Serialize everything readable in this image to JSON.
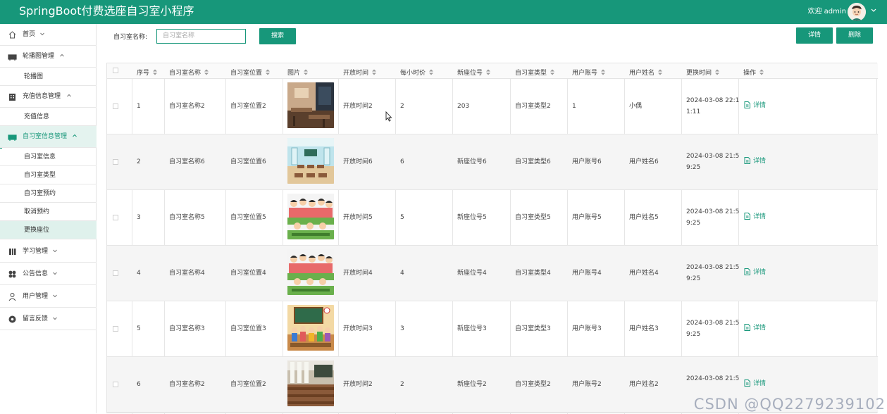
{
  "app": {
    "title": "SpringBoot付费选座自习室小程序",
    "welcome": "欢迎 admin"
  },
  "sidebar": {
    "items": [
      {
        "label": "首页",
        "icon": "home-icon",
        "expanded": false
      },
      {
        "label": "轮播图管理",
        "icon": "carousel-icon",
        "expanded": true
      },
      {
        "label": "充值信息管理",
        "icon": "building-icon",
        "expanded": true
      },
      {
        "label": "自习室信息管理",
        "icon": "carousel-icon",
        "expanded": true
      },
      {
        "label": "学习管理",
        "icon": "book-icon",
        "expanded": false
      },
      {
        "label": "公告信息",
        "icon": "grid-icon",
        "expanded": false
      },
      {
        "label": "用户管理",
        "icon": "user-icon",
        "expanded": false
      },
      {
        "label": "留言反馈",
        "icon": "feedback-icon",
        "expanded": false
      }
    ],
    "subitems": {
      "carousel": [
        "轮播图"
      ],
      "recharge": [
        "充值信息"
      ],
      "room": [
        "自习室信息",
        "自习室类型",
        "自习室预约",
        "取消预约",
        "更换座位"
      ]
    }
  },
  "search": {
    "label": "自习室名称:",
    "placeholder": "自习室名称",
    "button": "搜索"
  },
  "actions": {
    "detail": "详情",
    "delete": "删除"
  },
  "table": {
    "headers": [
      "序号",
      "自习室名称",
      "自习室位置",
      "图片",
      "开放时间",
      "每小时价",
      "新座位号",
      "自习室类型",
      "用户账号",
      "用户姓名",
      "更换时间",
      "操作"
    ],
    "rows": [
      {
        "idx": "1",
        "name": "自习室名称2",
        "pos": "自习室位置2",
        "open": "开放时间2",
        "price": "2",
        "seat": "203",
        "type": "自习室类型2",
        "account": "1",
        "user": "小偶",
        "time1": "2024-03-08 22:1",
        "time2": "1:11",
        "img": "classroom-photo"
      },
      {
        "idx": "2",
        "name": "自习室名称6",
        "pos": "自习室位置6",
        "open": "开放时间6",
        "price": "6",
        "seat": "新座位号6",
        "type": "自习室类型6",
        "account": "用户账号6",
        "user": "用户姓名6",
        "time1": "2024-03-08 21:5",
        "time2": "9:25",
        "img": "empty-classroom-illustration"
      },
      {
        "idx": "3",
        "name": "自习室名称5",
        "pos": "自习室位置5",
        "open": "开放时间5",
        "price": "5",
        "seat": "新座位号5",
        "type": "自习室类型5",
        "account": "用户账号5",
        "user": "用户姓名5",
        "time1": "2024-03-08 21:5",
        "time2": "9:25",
        "img": "students-cartoon"
      },
      {
        "idx": "4",
        "name": "自习室名称4",
        "pos": "自习室位置4",
        "open": "开放时间4",
        "price": "4",
        "seat": "新座位号4",
        "type": "自习室类型4",
        "account": "用户账号4",
        "user": "用户姓名4",
        "time1": "2024-03-08 21:5",
        "time2": "9:25",
        "img": "students-cartoon"
      },
      {
        "idx": "5",
        "name": "自习室名称3",
        "pos": "自习室位置3",
        "open": "开放时间3",
        "price": "3",
        "seat": "新座位号3",
        "type": "自习室类型3",
        "account": "用户账号3",
        "user": "用户姓名3",
        "time1": "2024-03-08 21:5",
        "time2": "9:25",
        "img": "classroom-cartoon"
      },
      {
        "idx": "6",
        "name": "自习室名称2",
        "pos": "自习室位置2",
        "open": "开放时间2",
        "price": "2",
        "seat": "新座位号2",
        "type": "自习室类型2",
        "account": "用户账号2",
        "user": "用户姓名2",
        "time1": "2024-03-08 21:5",
        "time2": "",
        "img": "lecture-hall-photo"
      }
    ],
    "row_action": "详情"
  },
  "watermark": "CSDN @QQ2279239102",
  "colors": {
    "accent": "#17977a",
    "active_bg": "#e4f3ef"
  }
}
